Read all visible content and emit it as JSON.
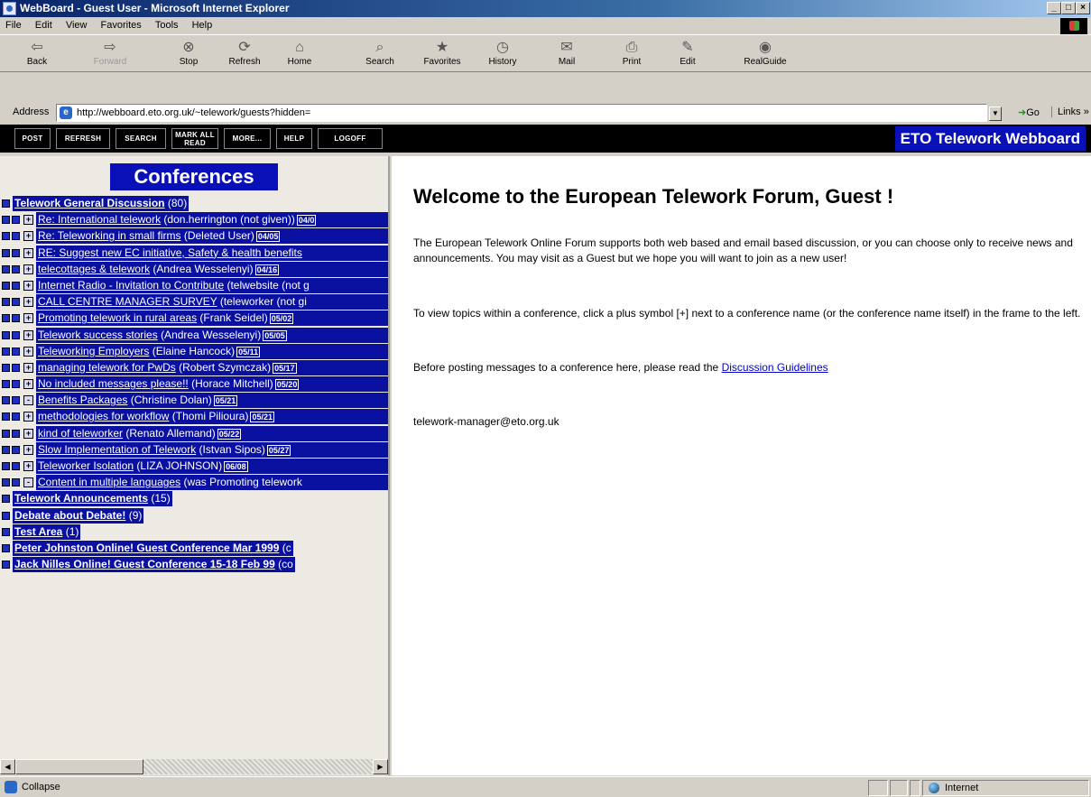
{
  "window": {
    "title": "WebBoard - Guest User - Microsoft Internet Explorer"
  },
  "menubar": [
    "File",
    "Edit",
    "View",
    "Favorites",
    "Tools",
    "Help"
  ],
  "toolbar": [
    {
      "label": "Back",
      "icon": "back-arrow-icon",
      "glyph": "⇦",
      "enabled": true
    },
    {
      "label": "Forward",
      "icon": "forward-arrow-icon",
      "glyph": "⇨",
      "enabled": false
    },
    {
      "label": "Stop",
      "icon": "stop-icon",
      "glyph": "⊗",
      "enabled": true
    },
    {
      "label": "Refresh",
      "icon": "refresh-icon",
      "glyph": "⟳",
      "enabled": true
    },
    {
      "label": "Home",
      "icon": "home-icon",
      "glyph": "⌂",
      "enabled": true
    },
    {
      "label": "Search",
      "icon": "search-icon",
      "glyph": "⌕",
      "enabled": true
    },
    {
      "label": "Favorites",
      "icon": "favorites-icon",
      "glyph": "★",
      "enabled": true
    },
    {
      "label": "History",
      "icon": "history-icon",
      "glyph": "◷",
      "enabled": true
    },
    {
      "label": "Mail",
      "icon": "mail-icon",
      "glyph": "✉",
      "enabled": true
    },
    {
      "label": "Print",
      "icon": "print-icon",
      "glyph": "⎙",
      "enabled": true
    },
    {
      "label": "Edit",
      "icon": "edit-icon",
      "glyph": "✎",
      "enabled": true
    },
    {
      "label": "RealGuide",
      "icon": "realguide-icon",
      "glyph": "◉",
      "enabled": true
    }
  ],
  "address": {
    "label": "Address",
    "url": "http://webboard.eto.org.uk/~telework/guests?hidden=",
    "go_label": "Go",
    "links_label": "Links »"
  },
  "webboard_toolbar": {
    "buttons": [
      "POST",
      "REFRESH",
      "SEARCH",
      "MARK ALL READ",
      "MORE...",
      "HELP",
      "LOGOFF"
    ],
    "brand": "ETO Telework Webboard"
  },
  "left_panel": {
    "heading": "Conferences",
    "rows": [
      {
        "kind": "conf",
        "title": "Telework General Discussion",
        "meta": "(80)"
      },
      {
        "kind": "topic",
        "icon": "+",
        "title": "Re: International telework",
        "author": "(don.herrington (not given))",
        "date": "04/0"
      },
      {
        "kind": "topic",
        "icon": "+",
        "title": "Re: Teleworking in small firms",
        "author": "(Deleted User)",
        "date": "04/05"
      },
      {
        "kind": "topic",
        "icon": "+",
        "title": "RE: Suggest new EC initiative, Safety & health benefits",
        "author": "",
        "date": ""
      },
      {
        "kind": "topic",
        "icon": "+",
        "title": "telecottages & telework",
        "author": "(Andrea Wesselenyi)",
        "date": "04/16"
      },
      {
        "kind": "topic",
        "icon": "+",
        "title": "Internet Radio - Invitation to Contribute",
        "author": "(telwebsite (not g",
        "date": ""
      },
      {
        "kind": "topic",
        "icon": "+",
        "title": "CALL CENTRE MANAGER SURVEY",
        "author": "(teleworker (not gi",
        "date": ""
      },
      {
        "kind": "topic",
        "icon": "+",
        "title": "Promoting telework in rural areas",
        "author": "(Frank Seidel)",
        "date": "05/02"
      },
      {
        "kind": "topic",
        "icon": "+",
        "title": "Telework success stories",
        "author": "(Andrea Wesselenyi)",
        "date": "05/05"
      },
      {
        "kind": "topic",
        "icon": "+",
        "title": "Teleworking Employers",
        "author": "(Elaine Hancock)",
        "date": "05/11"
      },
      {
        "kind": "topic",
        "icon": "+",
        "title": "managing telework for PwDs",
        "author": "(Robert Szymczak)",
        "date": "05/17"
      },
      {
        "kind": "topic",
        "icon": "+",
        "title": "No included messages please!!",
        "author": "(Horace Mitchell)",
        "date": "05/20"
      },
      {
        "kind": "topic",
        "icon": "-",
        "title": "Benefits Packages",
        "author": "(Christine Dolan)",
        "date": "05/21"
      },
      {
        "kind": "topic",
        "icon": "+",
        "title": "methodologies for workflow",
        "author": "(Thomi Pilioura)",
        "date": "05/21"
      },
      {
        "kind": "topic",
        "icon": "+",
        "title": "kind of teleworker",
        "author": "(Renato Allemand)",
        "date": "05/22"
      },
      {
        "kind": "topic",
        "icon": "+",
        "title": "Slow Implementation of Telework",
        "author": "(Istvan Sipos)",
        "date": "05/27"
      },
      {
        "kind": "topic",
        "icon": "+",
        "title": "Teleworker Isolation",
        "author": "(LIZA JOHNSON)",
        "date": "06/08"
      },
      {
        "kind": "topic",
        "icon": "-",
        "title": "Content in multiple languages",
        "author": "(was Promoting telework",
        "date": ""
      },
      {
        "kind": "conf",
        "title": "Telework Announcements",
        "meta": "(15)"
      },
      {
        "kind": "conf",
        "title": "Debate about Debate!",
        "meta": "(9)"
      },
      {
        "kind": "conf",
        "title": "Test Area",
        "meta": "(1)"
      },
      {
        "kind": "conf",
        "title": "Peter Johnston Online! Guest Conference Mar 1999",
        "meta": "(c"
      },
      {
        "kind": "conf",
        "title": "Jack Nilles Online! Guest Conference 15-18 Feb 99",
        "meta": "(co"
      }
    ]
  },
  "main": {
    "heading": "Welcome to the European Telework Forum, Guest !",
    "para1": "The European Telework Online Forum supports both web based and email based discussion, or you can choose only to receive news and announcements. You may visit as a Guest but we hope you will want to join as a new user!",
    "para2": "To view topics within a conference, click a plus symbol [+] next to a conference name (or the conference name itself) in the frame to the left.",
    "para3_text": "Before posting messages to a conference here, please read the",
    "para3_link": "Discussion Guidelines",
    "email": "telework-manager@eto.org.uk"
  },
  "status": {
    "text": "Collapse",
    "zone": "Internet"
  },
  "colors": {
    "highlight": "#0a10a0",
    "brand": "#0a10b8",
    "link": "#0000cc",
    "chrome": "#d4d0c8"
  }
}
